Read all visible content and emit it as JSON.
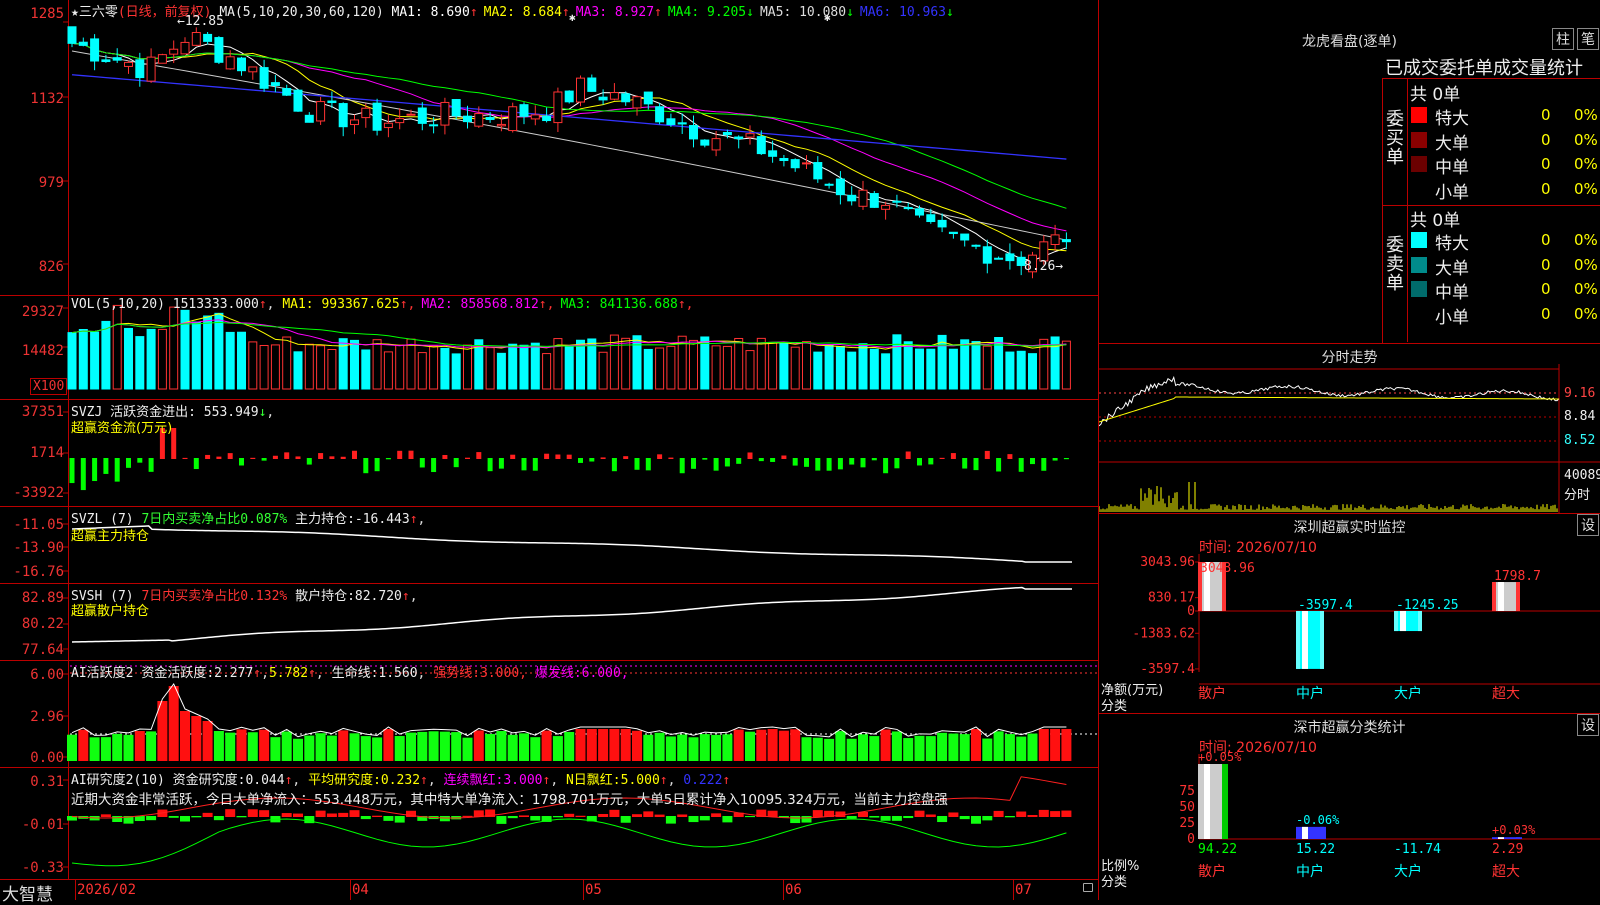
{
  "app": {
    "name": "大智慧"
  },
  "price_panel": {
    "star": "★",
    "stock_name": "三六零",
    "mode": "(日线，前复权)",
    "ma_prefix": "MA(5,10,20,30,60,120)",
    "ma": [
      {
        "label": "MA1:",
        "value": "8.690",
        "arrow": "↑",
        "color": "#ffffff"
      },
      {
        "label": "MA2:",
        "value": "8.684",
        "arrow": "↑",
        "color": "#ffff00"
      },
      {
        "label": "MA3:",
        "value": "8.927",
        "arrow": "↑",
        "color": "#ff00ff"
      },
      {
        "label": "MA4:",
        "value": "9.205",
        "arrow": "↓",
        "color": "#00ff00"
      },
      {
        "label": "MA5:",
        "value": "10.080",
        "arrow": "↓",
        "color": "#dddddd"
      },
      {
        "label": "MA6:",
        "value": "10.963",
        "arrow": "↓",
        "color": "#3333ff"
      }
    ],
    "high_label": "←12.85",
    "low_label": "8.26→",
    "y_ticks": [
      "1285",
      "1132",
      "979",
      "826"
    ],
    "star_markers": [
      "✱",
      "✱"
    ]
  },
  "vol_panel": {
    "header": "VOL(5,10,20)",
    "value": "1513333.000",
    "ma": [
      {
        "label": "MA1:",
        "value": "993367.625",
        "arrow": "↑",
        "color": "#ffff00"
      },
      {
        "label": "MA2:",
        "value": "858568.812",
        "arrow": "↑",
        "color": "#ff00ff"
      },
      {
        "label": "MA3:",
        "value": "841136.688",
        "arrow": "↑",
        "color": "#00ff00"
      }
    ],
    "y_ticks": [
      "29327",
      "14482"
    ],
    "unit": "X100"
  },
  "svzj_panel": {
    "header": "SVZJ  活跃资金进出:",
    "value": "553.949",
    "arrow": "↓",
    "subtitle": "超赢资金流(万元)",
    "y_ticks": [
      "37351",
      "1714",
      "-33922"
    ]
  },
  "svzl_panel": {
    "header": "SVZL (7)",
    "pct_label": "7日内买卖净占比0.087%",
    "main_label": "主力持仓:",
    "main_value": "-16.443",
    "subtitle": "超赢主力持仓",
    "y_ticks": [
      "-11.05",
      "-13.90",
      "-16.76"
    ]
  },
  "svsh_panel": {
    "header": "SVSH (7)",
    "pct_label": "7日内买卖净占比0.132%",
    "main_label": "散户持仓:",
    "main_value": "82.720",
    "subtitle": "超赢散户持仓",
    "y_ticks": [
      "82.89",
      "80.22",
      "77.64"
    ]
  },
  "ai_active_panel": {
    "header": "AI活跃度2",
    "act_label": "资金活跃度:",
    "act_value": "2.277",
    "act2": "5.782",
    "life_label": "生命线:",
    "life_value": "1.560",
    "strong_label": "强势线:",
    "strong_value": "3.000",
    "burst_label": "爆发线:",
    "burst_value": "6.000",
    "y_ticks": [
      "6.00",
      "2.96",
      "0.00"
    ]
  },
  "ai_research_panel": {
    "header": "AI研究度2(10)",
    "r_label": "资金研究度:",
    "r_value": "0.044",
    "avg_label": "平均研究度:",
    "avg_value": "0.232",
    "cont_label": "连续飘红:",
    "cont_value": "3.000",
    "n_label": "N日飘红:",
    "n_value": "5.000",
    "last_value": "0.222",
    "comment": "近期大资金非常活跃，今日大单净流入：553.448万元，其中特大单净流入：1798.701万元，大单5日累计净入10095.324万元，当前主力控盘强",
    "y_ticks": [
      "0.31",
      "-0.01",
      "-0.33"
    ]
  },
  "x_axis": [
    "2026/02",
    "04",
    "05",
    "06",
    "07"
  ],
  "dragon_panel": {
    "title": "龙虎看盘(逐单)",
    "btn1": "柱",
    "btn2": "笔",
    "section_title": "已成交委托单成交量统计",
    "buy": {
      "side": "委买单",
      "total": "共 0单",
      "rows": [
        {
          "label": "特大",
          "value": "0",
          "pct": "0%",
          "color": "#ff0000"
        },
        {
          "label": "大单",
          "value": "0",
          "pct": "0%",
          "color": "#8b0000"
        },
        {
          "label": "中单",
          "value": "0",
          "pct": "0%",
          "color": "#6b0000"
        },
        {
          "label": "小单",
          "value": "0",
          "pct": "0%",
          "color": "#000000"
        }
      ]
    },
    "sell": {
      "side": "委卖单",
      "total": "共 0单",
      "rows": [
        {
          "label": "特大",
          "value": "0",
          "pct": "0%",
          "color": "#00ffff"
        },
        {
          "label": "大单",
          "value": "0",
          "pct": "0%",
          "color": "#008b8b"
        },
        {
          "label": "中单",
          "value": "0",
          "pct": "0%",
          "color": "#006b6b"
        },
        {
          "label": "小单",
          "value": "0",
          "pct": "0%",
          "color": "#000000"
        }
      ]
    }
  },
  "intraday": {
    "title": "分时走势",
    "y_ticks": [
      "9.16",
      "8.84",
      "8.52"
    ],
    "vol_label": "40089",
    "vol_unit": "分时"
  },
  "sz_monitor": {
    "title": "深圳超赢实时监控",
    "settings": "设",
    "time": "时间: 2026/07/10",
    "y_ticks": [
      "3043.96",
      "830.17",
      "0",
      "-1383.62",
      "-3597.4"
    ],
    "y_caption": "净额(万元)",
    "x_caption": "分类",
    "bars": [
      {
        "label": "散户",
        "value": "3043.96",
        "v": 3043.96
      },
      {
        "label": "中户",
        "value": "-3597.4",
        "v": -3597.4
      },
      {
        "label": "大户",
        "value": "-1245.25",
        "v": -1245.25
      },
      {
        "label": "超大",
        "value": "1798.7",
        "v": 1798.7
      }
    ]
  },
  "sz_classify": {
    "title": "深市超赢分类统计",
    "settings": "设",
    "time": "时间: 2026/07/10",
    "y_ticks": [
      "75",
      "50",
      "25",
      "0"
    ],
    "y_caption": "比例%",
    "x_caption": "分类",
    "bars": [
      {
        "label": "散户",
        "value": "94.22",
        "change": "+0.05%",
        "v": 94.22
      },
      {
        "label": "中户",
        "value": "15.22",
        "change": "-0.06%",
        "v": 15.22
      },
      {
        "label": "大户",
        "value": "-11.74",
        "change": "",
        "v": -11.74
      },
      {
        "label": "超大",
        "value": "2.29",
        "change": "+0.03%",
        "v": 2.29
      }
    ]
  },
  "colors": {
    "up": "#ff3333",
    "down": "#00ffff",
    "axis": "#bb0000",
    "green": "#00ff00"
  }
}
